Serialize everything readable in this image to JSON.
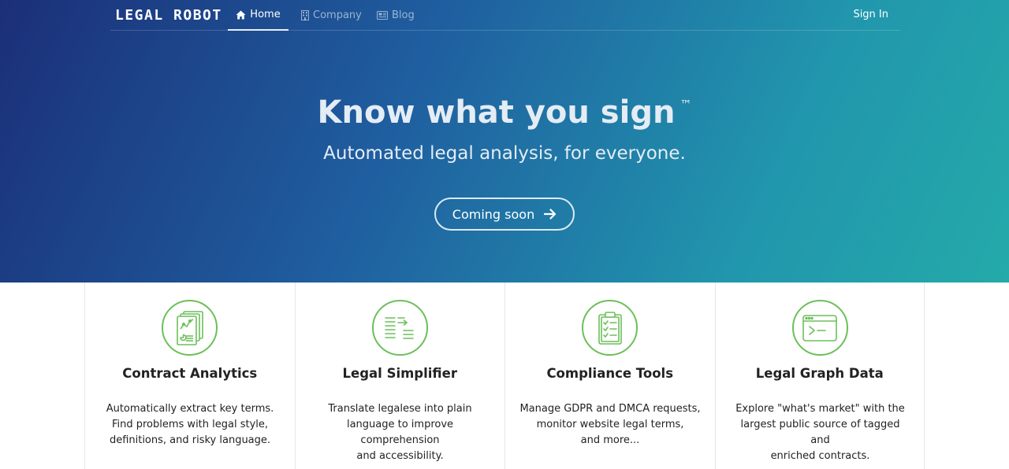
{
  "brand": {
    "logo": "LEGAL ROBOT"
  },
  "nav": {
    "home": "Home",
    "company": "Company",
    "blog": "Blog",
    "signin": "Sign In"
  },
  "hero": {
    "headline": "Know what you sign",
    "trademark": "™",
    "tagline": "Automated legal analysis, for everyone.",
    "cta": "Coming soon"
  },
  "features": [
    {
      "icon": "contract-analytics-icon",
      "title": "Contract Analytics",
      "lines": [
        "Automatically extract key terms.",
        "Find problems with legal style,",
        "definitions, and risky language."
      ]
    },
    {
      "icon": "legal-simplifier-icon",
      "title": "Legal Simplifier",
      "lines": [
        "Translate legalese into plain",
        "language to improve comprehension",
        "and accessibility."
      ]
    },
    {
      "icon": "compliance-clipboard-icon",
      "title": "Compliance Tools",
      "lines": [
        "Manage GDPR and DMCA requests,",
        "monitor website legal terms,",
        "and more..."
      ]
    },
    {
      "icon": "terminal-window-icon",
      "title": "Legal Graph Data",
      "lines": [
        "Explore \"what's market\" with the",
        "largest public source of tagged and",
        "enriched contracts."
      ]
    }
  ],
  "colors": {
    "accent_green": "#6cbf5a",
    "hero_start": "#1b2f78",
    "hero_end": "#24aaa9"
  }
}
